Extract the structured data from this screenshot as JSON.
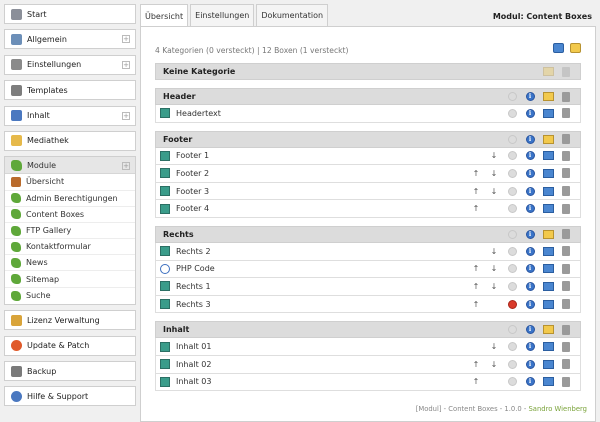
{
  "sidebar": {
    "items": [
      {
        "label": "Start",
        "icon": "start-icon",
        "color": "#8b8f99",
        "plus": false
      },
      {
        "label": "Allgemein",
        "icon": "allgemein-icon",
        "color": "#6c8fb8",
        "plus": true
      },
      {
        "label": "Einstellungen",
        "icon": "gear-icon",
        "color": "#8a8a8a",
        "plus": true
      },
      {
        "label": "Templates",
        "icon": "templates-icon",
        "color": "#7d7d7d",
        "plus": false
      },
      {
        "label": "Inhalt",
        "icon": "inhalt-icon",
        "color": "#4a78c0",
        "plus": true
      },
      {
        "label": "Mediathek",
        "icon": "folder-icon",
        "color": "#e6b94a",
        "plus": false
      }
    ],
    "module": {
      "label": "Module",
      "children": [
        {
          "label": "Übersicht",
          "icon": "box-icon",
          "color": "#b96b2c"
        },
        {
          "label": "Admin Berechtigungen",
          "icon": "puzzle-icon",
          "color": "#5fa83a"
        },
        {
          "label": "Content Boxes",
          "icon": "puzzle-icon",
          "color": "#5fa83a"
        },
        {
          "label": "FTP Gallery",
          "icon": "puzzle-icon",
          "color": "#5fa83a"
        },
        {
          "label": "Kontaktformular",
          "icon": "puzzle-icon",
          "color": "#5fa83a"
        },
        {
          "label": "News",
          "icon": "puzzle-icon",
          "color": "#5fa83a"
        },
        {
          "label": "Sitemap",
          "icon": "puzzle-icon",
          "color": "#5fa83a"
        },
        {
          "label": "Suche",
          "icon": "puzzle-icon",
          "color": "#5fa83a"
        }
      ]
    },
    "bottom": [
      {
        "label": "Lizenz Verwaltung",
        "icon": "key-icon",
        "color": "#d9a43a"
      },
      {
        "label": "Update & Patch",
        "icon": "update-icon",
        "color": "#e05a2a"
      },
      {
        "label": "Backup",
        "icon": "backup-icon",
        "color": "#7a7a7a"
      },
      {
        "label": "Hilfe & Support",
        "icon": "help-icon",
        "color": "#4a78c0"
      }
    ]
  },
  "tabs": [
    "Übersicht",
    "Einstellungen",
    "Dokumentation"
  ],
  "module_title": "Modul: Content Boxes",
  "summary": "4 Kategorien (0 versteckt) | 12 Boxen (1 versteckt)",
  "sections": [
    {
      "title": "Keine Kategorie",
      "rows": []
    },
    {
      "title": "Header",
      "rows": [
        {
          "label": "Headertext",
          "type": "doc",
          "up": false,
          "down": false,
          "visible": true
        }
      ]
    },
    {
      "title": "Footer",
      "rows": [
        {
          "label": "Footer 1",
          "type": "doc",
          "up": false,
          "down": true,
          "visible": true
        },
        {
          "label": "Footer 2",
          "type": "doc",
          "up": true,
          "down": true,
          "visible": true
        },
        {
          "label": "Footer 3",
          "type": "doc",
          "up": true,
          "down": true,
          "visible": true
        },
        {
          "label": "Footer 4",
          "type": "doc",
          "up": true,
          "down": false,
          "visible": true
        }
      ]
    },
    {
      "title": "Rechts",
      "rows": [
        {
          "label": "Rechts 2",
          "type": "doc",
          "up": false,
          "down": true,
          "visible": true
        },
        {
          "label": "PHP Code",
          "type": "php",
          "up": true,
          "down": true,
          "visible": true
        },
        {
          "label": "Rechts 1",
          "type": "doc",
          "up": true,
          "down": true,
          "visible": true
        },
        {
          "label": "Rechts 3",
          "type": "doc",
          "up": true,
          "down": false,
          "visible": false
        }
      ]
    },
    {
      "title": "Inhalt",
      "rows": [
        {
          "label": "Inhalt 01",
          "type": "doc",
          "up": false,
          "down": true,
          "visible": true
        },
        {
          "label": "Inhalt 02",
          "type": "doc",
          "up": true,
          "down": true,
          "visible": true
        },
        {
          "label": "Inhalt 03",
          "type": "doc",
          "up": true,
          "down": false,
          "visible": true
        }
      ]
    }
  ],
  "footer": {
    "text": "[Modul] - Content Boxes - 1.0.0 - ",
    "author": "Sandro Wienberg"
  },
  "glyphs": {
    "up": "↑",
    "down": "↓",
    "plus": "+",
    "info": "i"
  }
}
